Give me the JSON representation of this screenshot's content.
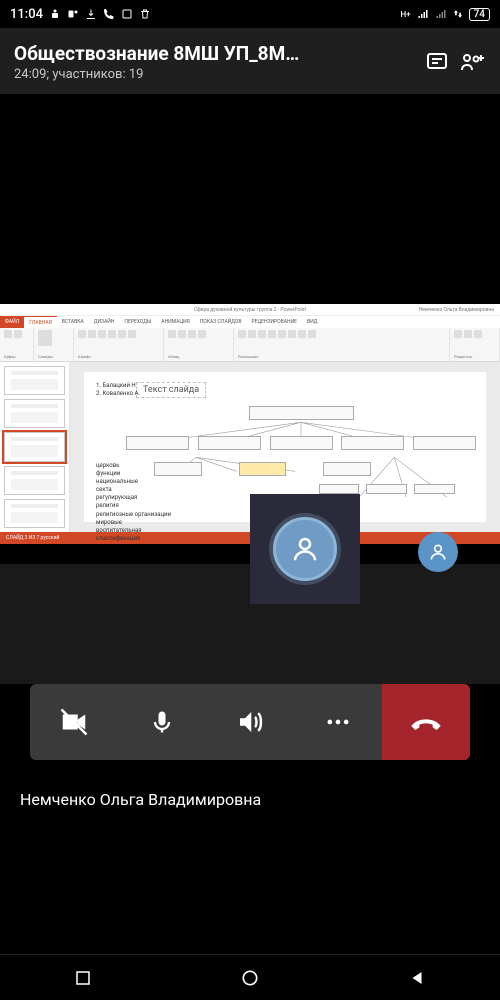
{
  "status": {
    "time": "11:04",
    "battery": "74"
  },
  "meeting": {
    "title": "Обществознание 8МШ УП_8М…",
    "duration": "24:09",
    "participants_label": "участников: 19"
  },
  "powerpoint": {
    "window_title": "Сфера духовной культуры группа 2 - PowerPoint",
    "user": "Немченко Ольга Владимировна",
    "tabs": [
      "ФАЙЛ",
      "ГЛАВНАЯ",
      "ВСТАВКА",
      "ДИЗАЙН",
      "ПЕРЕХОДЫ",
      "АНИМАЦИЯ",
      "ПОКАЗ СЛАЙДОВ",
      "РЕЦЕНЗИРОВАНИЕ",
      "ВИД"
    ],
    "active_tab_index": 1,
    "ribbon_groups": [
      "Буфер",
      "Слайды",
      "Шрифт",
      "Абзац",
      "Рисование",
      "Редактир."
    ],
    "status_bar": "СЛАЙД 3 ИЗ 7   русский",
    "slide": {
      "title_placeholder": "Текст слайда",
      "names": [
        "1. Балацкий Н",
        "2. Коваленко А."
      ],
      "terms": [
        "церковь",
        "функции",
        "национальные",
        "секта",
        "регулирующая",
        "религия",
        "религиозные организации",
        "мировые",
        "воспитательная",
        "классификация"
      ]
    }
  },
  "speaker": "Немченко Ольга Владимировна"
}
